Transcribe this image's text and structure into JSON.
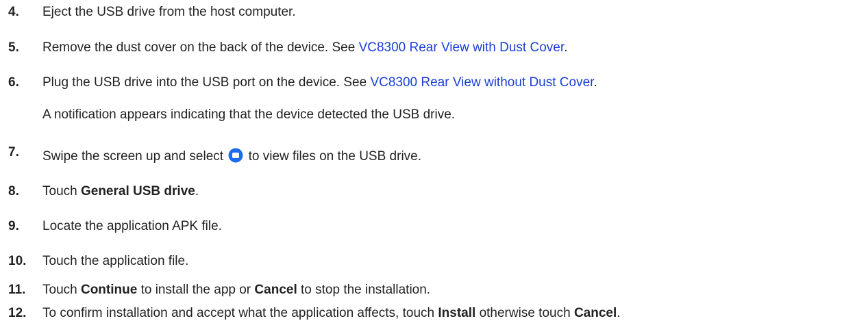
{
  "steps": [
    {
      "num": "4.",
      "text": "Eject the USB drive from the host computer."
    },
    {
      "num": "5.",
      "before": "Remove the dust cover on the back of the device. See ",
      "link": "VC8300 Rear View with Dust Cover",
      "after": "."
    },
    {
      "num": "6.",
      "before": "Plug the USB drive into the USB port on the device. See ",
      "link": "VC8300 Rear View without Dust Cover",
      "after": ".",
      "note": "A notification appears indicating that the device detected the USB drive."
    },
    {
      "num": "7.",
      "before": "Swipe the screen up and select ",
      "icon": "files-app-icon",
      "after": " to view files on the USB drive."
    },
    {
      "num": "8.",
      "before": "Touch ",
      "bold": "General USB drive",
      "after": "."
    },
    {
      "num": "9.",
      "text": "Locate the application APK file."
    },
    {
      "num": "10.",
      "text": "Touch the application file."
    },
    {
      "num": "11.",
      "before": "Touch ",
      "bold1": "Continue",
      "mid": " to install the app or ",
      "bold2": "Cancel",
      "after": " to stop the installation."
    },
    {
      "num": "12.",
      "before": "To confirm installation and accept what the application affects, touch ",
      "bold1": "Install",
      "mid": " otherwise touch ",
      "bold2": "Cancel",
      "after": "."
    }
  ],
  "colors": {
    "link": "#1a3fd6",
    "text": "#222222",
    "icon": "#1e6bf0"
  }
}
